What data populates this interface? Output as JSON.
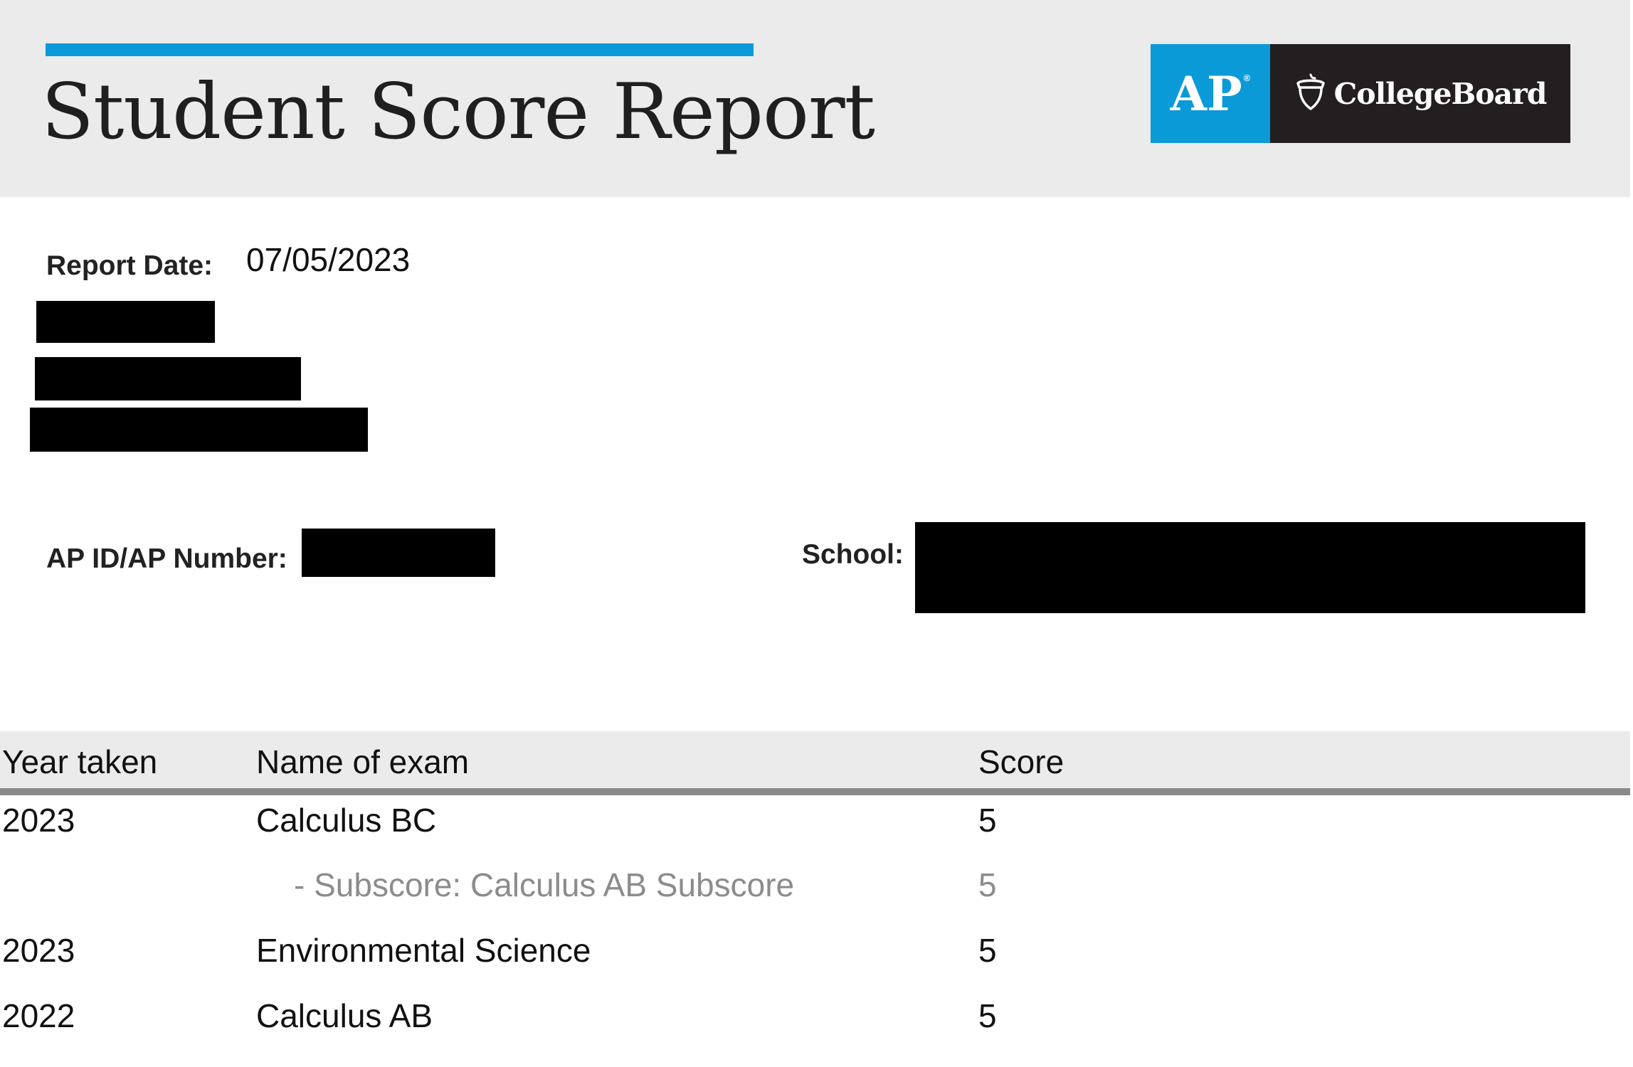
{
  "header": {
    "title": "Student Score Report",
    "logo": {
      "ap_text": "AP",
      "ap_reg": "®",
      "brand_text": "CollegeBoard",
      "brand_icon": "acorn-icon",
      "ap_color": "#0b9ad8",
      "brand_bg": "#231f20"
    },
    "accent_color": "#0b9ad8"
  },
  "student_info": {
    "report_date_label": "Report Date:",
    "report_date_value": "07/05/2023",
    "ap_id_label": "AP ID/AP Number:",
    "school_label": "School:"
  },
  "scores_table": {
    "columns": [
      "Year taken",
      "Name of exam",
      "Score"
    ],
    "rows": [
      {
        "year": "2023",
        "exam": "Calculus BC",
        "score": "5",
        "type": "exam"
      },
      {
        "year": "",
        "exam": "- Subscore: Calculus AB Subscore",
        "score": "5",
        "type": "subscore"
      },
      {
        "year": "2023",
        "exam": "Environmental Science",
        "score": "5",
        "type": "exam"
      },
      {
        "year": "2022",
        "exam": "Calculus AB",
        "score": "5",
        "type": "exam"
      }
    ]
  }
}
